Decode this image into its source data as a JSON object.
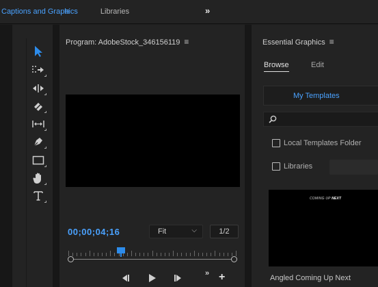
{
  "workspace": {
    "active_tab": "Captions and Graphics",
    "menu_icon": "≡",
    "libraries_tab": "Libraries",
    "more_tabs": "»"
  },
  "tools": [
    "selection-tool",
    "track-select-tool",
    "ripple-edit-tool",
    "razor-tool",
    "slip-tool",
    "pen-tool",
    "rectangle-tool",
    "hand-tool",
    "type-tool"
  ],
  "program": {
    "title": "Program: AdobeStock_346156119",
    "menu_icon": "≡",
    "timecode": "00;00;04;16",
    "zoom": "Fit",
    "resolution": "1/2",
    "playhead_fraction": 0.33,
    "more": "»",
    "add": "+"
  },
  "essential_graphics": {
    "title": "Essential Graphics",
    "menu_icon": "≡",
    "tabs": {
      "browse": "Browse",
      "edit": "Edit"
    },
    "templates_button": "My Templates",
    "search_placeholder": "",
    "local_folder_label": "Local Templates Folder",
    "libraries_label": "Libraries",
    "thumbnail": {
      "text_prefix": "COMING UP ",
      "text_bold": "NEXT"
    },
    "template_name": "Angled Coming Up Next"
  },
  "colors": {
    "accent": "#4aa2ff",
    "panel": "#232323",
    "frame": "#171717",
    "playhead": "#2d8ceb"
  }
}
